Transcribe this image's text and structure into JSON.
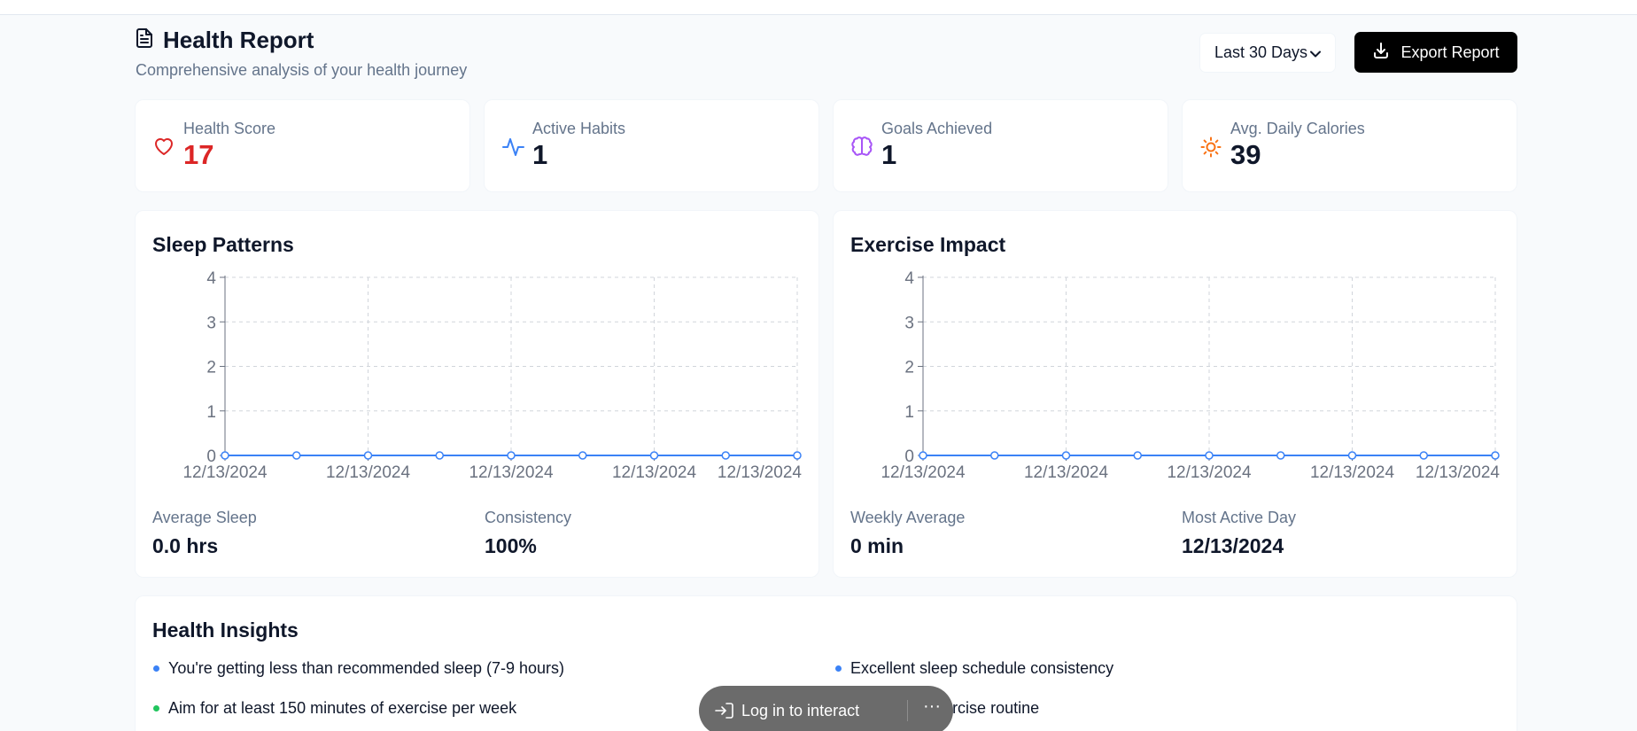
{
  "header": {
    "title": "Health Report",
    "subtitle": "Comprehensive analysis of your health journey",
    "icon": "file-text-icon",
    "range": "Last 30 Days",
    "export_label": "Export Report"
  },
  "stats": [
    {
      "label": "Health Score",
      "value": "17",
      "icon": "heart-icon",
      "color": "#dc2626"
    },
    {
      "label": "Active Habits",
      "value": "1",
      "icon": "activity-icon",
      "color": "#3b82f6"
    },
    {
      "label": "Goals Achieved",
      "value": "1",
      "icon": "brain-icon",
      "color": "#a855f7"
    },
    {
      "label": "Avg. Daily Calories",
      "value": "39",
      "icon": "sun-icon",
      "color": "#f97316"
    }
  ],
  "sleep": {
    "title": "Sleep Patterns",
    "metric1_label": "Average Sleep",
    "metric1_value": "0.0 hrs",
    "metric2_label": "Consistency",
    "metric2_value": "100%"
  },
  "exercise": {
    "title": "Exercise Impact",
    "metric1_label": "Weekly Average",
    "metric1_value": "0 min",
    "metric2_label": "Most Active Day",
    "metric2_value": "12/13/2024"
  },
  "insights": {
    "title": "Health Insights",
    "items": [
      {
        "text": "You're getting less than recommended sleep (7-9 hours)",
        "color": "#3b82f6"
      },
      {
        "text": "Excellent sleep schedule consistency",
        "color": "#3b82f6"
      },
      {
        "text": "Aim for at least 150 minutes of exercise per week",
        "color": "#22c55e"
      },
      {
        "text": "consistent exercise routine",
        "color": "#22c55e"
      }
    ]
  },
  "login": {
    "label": "Log in to interact",
    "more": "···"
  },
  "chart_data": [
    {
      "type": "line",
      "x": [
        "12/13/2024",
        "12/13/2024",
        "12/13/2024",
        "12/13/2024",
        "12/13/2024",
        "12/13/2024",
        "12/13/2024",
        "12/13/2024",
        "12/13/2024"
      ],
      "x_tick_labels": [
        "12/13/2024",
        "12/13/2024",
        "12/13/2024",
        "12/13/2024",
        "12/13/2024"
      ],
      "series": [
        {
          "values": [
            0,
            0,
            0,
            0,
            0,
            0,
            0,
            0,
            0
          ],
          "color": "#3b82f6"
        }
      ],
      "yticks": [
        0,
        1,
        2,
        3,
        4
      ],
      "ylim": [
        0,
        4
      ],
      "grid": true
    },
    {
      "type": "line",
      "x": [
        "12/13/2024",
        "12/13/2024",
        "12/13/2024",
        "12/13/2024",
        "12/13/2024",
        "12/13/2024",
        "12/13/2024",
        "12/13/2024",
        "12/13/2024"
      ],
      "x_tick_labels": [
        "12/13/2024",
        "12/13/2024",
        "12/13/2024",
        "12/13/2024",
        "12/13/2024"
      ],
      "series": [
        {
          "values": [
            0,
            0,
            0,
            0,
            0,
            0,
            0,
            0,
            0
          ],
          "color": "#3b82f6"
        }
      ],
      "yticks": [
        0,
        1,
        2,
        3,
        4
      ],
      "ylim": [
        0,
        4
      ],
      "grid": true
    }
  ]
}
